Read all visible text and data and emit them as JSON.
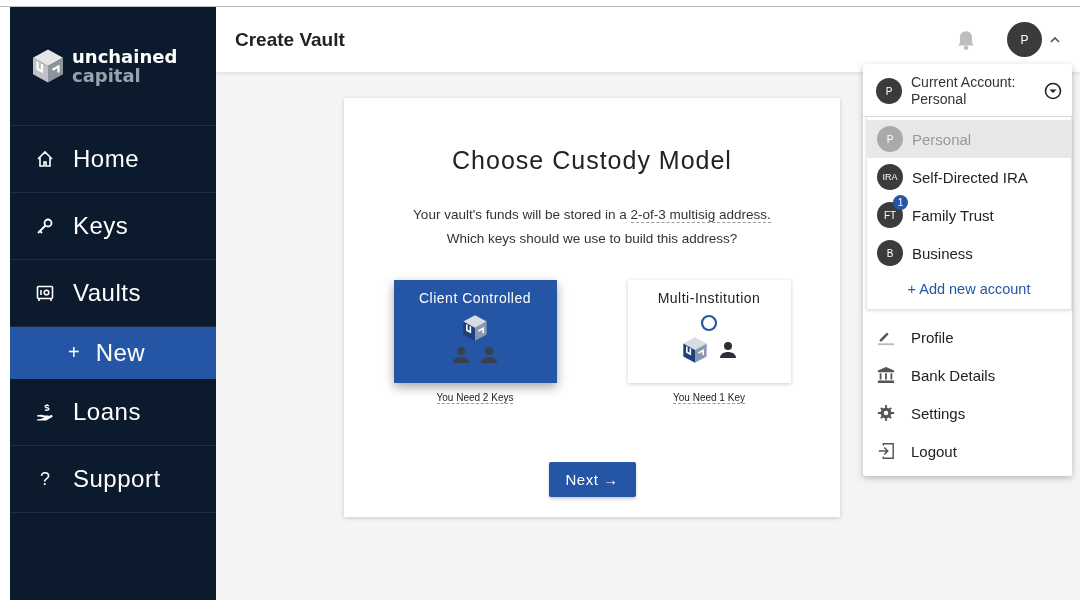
{
  "sidebar": {
    "logo": {
      "line1": "unchained",
      "line2": "capital"
    },
    "items": [
      {
        "kind": "home",
        "label": "Home",
        "selected": false
      },
      {
        "kind": "key",
        "label": "Keys",
        "selected": false
      },
      {
        "kind": "safe",
        "label": "Vaults",
        "selected": false,
        "children": [
          {
            "kind": "add",
            "glyph": "+",
            "label": "New",
            "selected": true
          }
        ]
      },
      {
        "kind": "loans",
        "label": "Loans",
        "selected": false
      },
      {
        "kind": "help",
        "glyph": "?",
        "label": "Support",
        "selected": false
      }
    ]
  },
  "header": {
    "title": "Create Vault",
    "avatar": "P",
    "menu_expanded": true
  },
  "account_menu": {
    "current_label": "Current Account:",
    "current_name": "Personal",
    "current_avatar": "P",
    "accounts": [
      {
        "avatar": "P",
        "name": "Personal",
        "selected": true
      },
      {
        "avatar": "IRA",
        "name": "Self-Directed IRA",
        "selected": false
      },
      {
        "avatar": "FT",
        "name": "Family Trust",
        "selected": false,
        "badge": "1"
      },
      {
        "avatar": "B",
        "name": "Business",
        "selected": false
      }
    ],
    "add_account": "+ Add new account",
    "items": [
      {
        "kind": "profile",
        "label": "Profile"
      },
      {
        "kind": "bank",
        "label": "Bank Details"
      },
      {
        "kind": "settings",
        "label": "Settings"
      },
      {
        "kind": "logout",
        "label": "Logout"
      }
    ]
  },
  "card": {
    "title": "Choose Custody Model",
    "sentence_start": "Your vault's funds will be stored in a ",
    "sentence_link": "2-of-3 multisig address.",
    "question": "Which keys should we use to build this address?",
    "options": [
      {
        "kind": "client",
        "label": "Client Controlled",
        "selected": true,
        "need": "You Need 2 Keys"
      },
      {
        "kind": "multi",
        "label": "Multi-Institution",
        "selected": false,
        "need": "You Need 1 Key"
      }
    ],
    "next_button": "Next →"
  }
}
